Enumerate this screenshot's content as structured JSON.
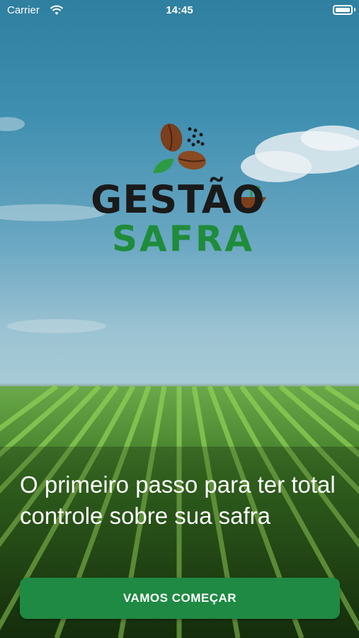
{
  "status_bar": {
    "carrier": "Carrier",
    "time": "14:45",
    "wifi_icon": "wifi-icon",
    "battery_icon": "battery-icon"
  },
  "logo": {
    "title": "GESTÃO",
    "subtitle": "SAFRA",
    "icons": [
      "coffee-beans-icon",
      "leaf-icon",
      "sprout-soil-icon"
    ],
    "title_color": "#1a1a1a",
    "subtitle_color": "#1f8c3b"
  },
  "hero": {
    "headline": "O primeiro passo para ter total controle sobre sua safra"
  },
  "cta": {
    "label": "VAMOS COMEÇAR",
    "color": "#1f8a43"
  }
}
